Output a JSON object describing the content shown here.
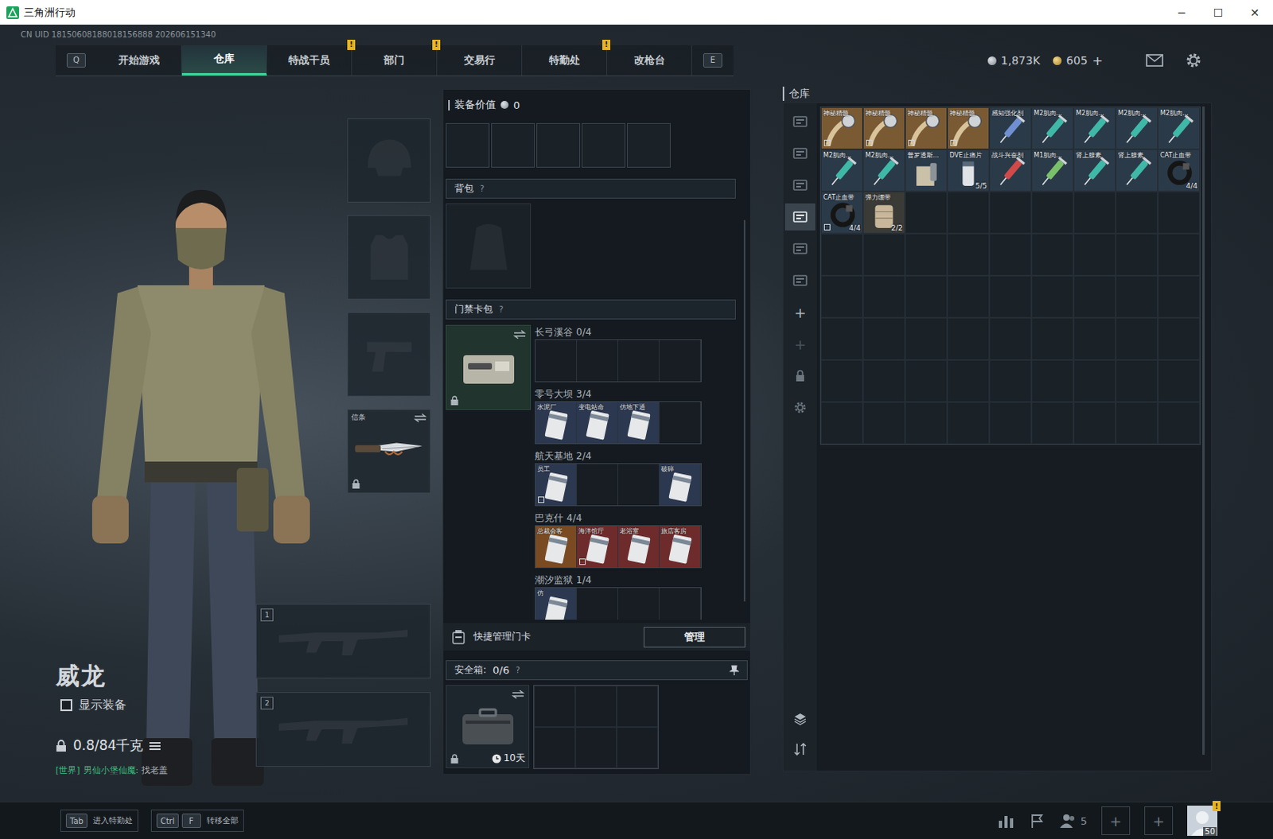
{
  "window": {
    "title": "三角洲行动",
    "controls": [
      "─",
      "☐",
      "✕"
    ]
  },
  "uid": "CN UID 18150608188018156888 202606151340",
  "nav": {
    "left_key": "Q",
    "right_key": "E",
    "alert_mark": "!",
    "tabs": [
      {
        "label": "开始游戏",
        "selected": false,
        "alert": false
      },
      {
        "label": "仓库",
        "selected": true,
        "alert": false
      },
      {
        "label": "特战干员",
        "selected": false,
        "alert": true
      },
      {
        "label": "部门",
        "selected": false,
        "alert": true
      },
      {
        "label": "交易行",
        "selected": false,
        "alert": false
      },
      {
        "label": "特勤处",
        "selected": false,
        "alert": true
      },
      {
        "label": "改枪台",
        "selected": false,
        "alert": false
      }
    ]
  },
  "currency": {
    "silver": "1,873K",
    "gold": "605",
    "add": "+"
  },
  "character": {
    "name": "威龙",
    "show_equipment": {
      "label": "显示装备",
      "checked": false
    },
    "weight": "0.8/84千克",
    "chat": {
      "channel": "[世界]",
      "sender": "男仙小堡仙魔:",
      "message": "找老盖"
    }
  },
  "equipment": {
    "slots": [
      {
        "kind": "helmet",
        "equipped": false
      },
      {
        "kind": "armor",
        "equipped": false
      },
      {
        "kind": "pistol",
        "equipped": false
      },
      {
        "kind": "melee",
        "equipped": true,
        "label": "信条",
        "locked": true
      }
    ],
    "weapon_slots": [
      "1",
      "2"
    ]
  },
  "loadout": {
    "value_label": "装备价值",
    "value": "0",
    "rig_slots": [
      {
        "filled": false
      },
      {
        "filled": false
      },
      {
        "filled": false
      },
      {
        "filled": false
      },
      {
        "filled": false
      }
    ],
    "backpack": {
      "label": "背包",
      "help": "?",
      "equipped": false
    },
    "keycards": {
      "label": "门禁卡包",
      "help": "?",
      "locked": true,
      "maps": [
        {
          "name": "长弓溪谷",
          "count": "0/4",
          "slots": [
            {
              "kind": "empty"
            },
            {
              "kind": "empty"
            },
            {
              "kind": "empty"
            },
            {
              "kind": "empty"
            }
          ]
        },
        {
          "name": "零号大坝",
          "count": "3/4",
          "slots": [
            {
              "kind": "card",
              "label": "水泥厂",
              "color": "#2c3850",
              "marked": false
            },
            {
              "kind": "card",
              "label": "变电站命",
              "color": "#2c3850",
              "marked": false
            },
            {
              "kind": "card",
              "label": "仿地下通",
              "color": "#2c3850",
              "marked": false
            },
            {
              "kind": "empty"
            }
          ]
        },
        {
          "name": "航天基地",
          "count": "2/4",
          "slots": [
            {
              "kind": "card",
              "label": "员工",
              "color": "#2c3850",
              "marked": true
            },
            {
              "kind": "empty"
            },
            {
              "kind": "empty"
            },
            {
              "kind": "card",
              "label": "破碎",
              "color": "#2c3850",
              "marked": false
            }
          ]
        },
        {
          "name": "巴克什",
          "count": "4/4",
          "slots": [
            {
              "kind": "card",
              "label": "总裁会客",
              "color": "#7a4b22",
              "marked": false
            },
            {
              "kind": "card",
              "label": "海洋馆厅",
              "color": "#6e2b2b",
              "marked": true
            },
            {
              "kind": "card",
              "label": "老浴室",
              "color": "#6e2b2b",
              "marked": false
            },
            {
              "kind": "card",
              "label": "旅店客房",
              "color": "#6e2b2b",
              "marked": false
            }
          ]
        },
        {
          "name": "潮汐监狱",
          "count": "1/4",
          "slots": [
            {
              "kind": "card",
              "label": "仿",
              "color": "#2c3850",
              "marked": false
            },
            {
              "kind": "empty"
            },
            {
              "kind": "empty"
            },
            {
              "kind": "empty"
            }
          ]
        }
      ]
    },
    "quick_manage": {
      "label": "快捷管理门卡",
      "button": "管理"
    },
    "safe": {
      "label": "安全箱:",
      "count": "0/6",
      "help": "?",
      "timer": "10天",
      "locked": true,
      "cells": [
        {
          "filled": false
        },
        {
          "filled": false
        },
        {
          "filled": false
        },
        {
          "filled": false
        },
        {
          "filled": false
        },
        {
          "filled": false
        }
      ]
    }
  },
  "warehouse": {
    "title": "仓库",
    "tabs": [
      {
        "selected": false
      },
      {
        "selected": false
      },
      {
        "selected": false
      },
      {
        "selected": true
      },
      {
        "selected": false
      },
      {
        "selected": false
      }
    ],
    "actions": [
      {
        "label": "+",
        "disabled": false
      },
      {
        "label": "+",
        "disabled": true
      }
    ],
    "items": [
      {
        "label": "神秘精髓",
        "kind": "watch",
        "color": "#7a5a33",
        "tint": "#d8c39a",
        "marked": true
      },
      {
        "label": "神秘精髓",
        "kind": "watch",
        "color": "#7a5a33",
        "tint": "#d8c39a",
        "marked": true
      },
      {
        "label": "神秘精髓",
        "kind": "watch",
        "color": "#7a5a33",
        "tint": "#d8c39a",
        "marked": true
      },
      {
        "label": "神秘精髓",
        "kind": "watch",
        "color": "#7a5a33",
        "tint": "#d8c39a",
        "marked": true
      },
      {
        "label": "感知强化剂",
        "kind": "syringe",
        "color": "#2b3a48",
        "tint": "#6f8fd0",
        "marked": false
      },
      {
        "label": "M2肌肉...",
        "kind": "syringe",
        "color": "#2b3a48",
        "tint": "#3fb8a8",
        "marked": false
      },
      {
        "label": "M2肌肉...",
        "kind": "syringe",
        "color": "#2b3a48",
        "tint": "#3fb8a8",
        "marked": false
      },
      {
        "label": "M2肌肉...",
        "kind": "syringe",
        "color": "#2b3a48",
        "tint": "#3fb8a8",
        "marked": false
      },
      {
        "label": "M2肌肉...",
        "kind": "syringe",
        "color": "#2b3a48",
        "tint": "#3fb8a8",
        "marked": false
      },
      {
        "label": "M2肌肉...",
        "kind": "syringe",
        "color": "#2b3a48",
        "tint": "#3fb8a8",
        "marked": false
      },
      {
        "label": "M2肌肉...",
        "kind": "syringe",
        "color": "#2b3a48",
        "tint": "#3fb8a8",
        "marked": false
      },
      {
        "label": "普罗透斯...",
        "kind": "box",
        "color": "#2b3a48",
        "tint": "#c9c1a8",
        "marked": false
      },
      {
        "label": "DVE止痛片",
        "kind": "pill",
        "color": "#2b3a48",
        "tint": "#dfe3e6",
        "count": "5/5",
        "marked": false
      },
      {
        "label": "战斗兴奋剂",
        "kind": "syringe",
        "color": "#2b3a48",
        "tint": "#d04a4a",
        "marked": false
      },
      {
        "label": "M1肌肉...",
        "kind": "syringe",
        "color": "#2b3a48",
        "tint": "#7ac06a",
        "marked": false
      },
      {
        "label": "肾上腺素",
        "kind": "syringe",
        "color": "#2b3a48",
        "tint": "#3fb8a8",
        "marked": false
      },
      {
        "label": "肾上腺素",
        "kind": "syringe",
        "color": "#2b3a48",
        "tint": "#3fb8a8",
        "marked": false
      },
      {
        "label": "CAT止血带",
        "kind": "tourniquet",
        "color": "#2b3a48",
        "tint": "#151515",
        "count": "4/4",
        "marked": false
      },
      {
        "label": "CAT止血带",
        "kind": "tourniquet",
        "color": "#2b3a48",
        "tint": "#151515",
        "count": "4/4",
        "marked": true
      },
      {
        "label": "弹力绷带",
        "kind": "bandage",
        "color": "#3a3a36",
        "tint": "#c8b79a",
        "count": "2/2",
        "marked": false
      }
    ]
  },
  "bottom_bar": {
    "hints": [
      {
        "keys": [
          "Tab"
        ],
        "label": "进入特勤处"
      },
      {
        "keys": [
          "Ctrl",
          "F"
        ],
        "label": "转移全部"
      }
    ],
    "friends": "5",
    "add_slots": [
      "+",
      "+"
    ],
    "level": "50",
    "alert": "!"
  }
}
